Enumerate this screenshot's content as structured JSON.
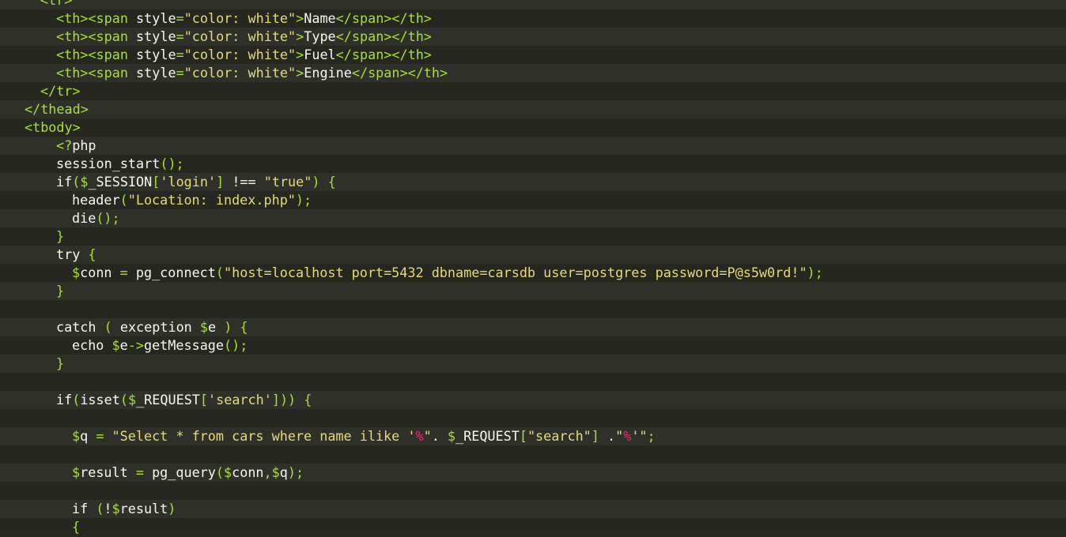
{
  "editor": {
    "language": "php",
    "colors": {
      "background": "#272822",
      "stripe_light": "#2f302a",
      "stripe_dark": "#262721",
      "text": "#f8f8f2",
      "punctuation": "#a6e22e",
      "string": "#e6db74",
      "accent": "#f92672"
    },
    "lines": [
      {
        "indent": 2,
        "tokens": [
          {
            "t": "<tr>",
            "c": "punc"
          }
        ]
      },
      {
        "indent": 3,
        "tokens": [
          {
            "t": "<th><span ",
            "c": "punc"
          },
          {
            "t": "style",
            "c": "text"
          },
          {
            "t": "=",
            "c": "punc"
          },
          {
            "t": "\"color: white\"",
            "c": "str"
          },
          {
            "t": ">",
            "c": "punc"
          },
          {
            "t": "Name",
            "c": "text"
          },
          {
            "t": "</span></th>",
            "c": "punc"
          }
        ]
      },
      {
        "indent": 3,
        "tokens": [
          {
            "t": "<th><span ",
            "c": "punc"
          },
          {
            "t": "style",
            "c": "text"
          },
          {
            "t": "=",
            "c": "punc"
          },
          {
            "t": "\"color: white\"",
            "c": "str"
          },
          {
            "t": ">",
            "c": "punc"
          },
          {
            "t": "Type",
            "c": "text"
          },
          {
            "t": "</span></th>",
            "c": "punc"
          }
        ]
      },
      {
        "indent": 3,
        "tokens": [
          {
            "t": "<th><span ",
            "c": "punc"
          },
          {
            "t": "style",
            "c": "text"
          },
          {
            "t": "=",
            "c": "punc"
          },
          {
            "t": "\"color: white\"",
            "c": "str"
          },
          {
            "t": ">",
            "c": "punc"
          },
          {
            "t": "Fuel",
            "c": "text"
          },
          {
            "t": "</span></th>",
            "c": "punc"
          }
        ]
      },
      {
        "indent": 3,
        "tokens": [
          {
            "t": "<th><span ",
            "c": "punc"
          },
          {
            "t": "style",
            "c": "text"
          },
          {
            "t": "=",
            "c": "punc"
          },
          {
            "t": "\"color: white\"",
            "c": "str"
          },
          {
            "t": ">",
            "c": "punc"
          },
          {
            "t": "Engine",
            "c": "text"
          },
          {
            "t": "</span></th>",
            "c": "punc"
          }
        ]
      },
      {
        "indent": 2,
        "tokens": [
          {
            "t": "</tr>",
            "c": "punc"
          }
        ]
      },
      {
        "indent": 1,
        "tokens": [
          {
            "t": "</thead>",
            "c": "punc"
          }
        ]
      },
      {
        "indent": 1,
        "tokens": [
          {
            "t": "<tbody>",
            "c": "punc"
          }
        ]
      },
      {
        "indent": 3,
        "tokens": [
          {
            "t": "<?",
            "c": "punc"
          },
          {
            "t": "php",
            "c": "text"
          }
        ]
      },
      {
        "indent": 3,
        "tokens": [
          {
            "t": "session_start",
            "c": "text"
          },
          {
            "t": "();",
            "c": "punc"
          }
        ]
      },
      {
        "indent": 3,
        "tokens": [
          {
            "t": "if",
            "c": "text"
          },
          {
            "t": "($",
            "c": "punc"
          },
          {
            "t": "_SESSION",
            "c": "text"
          },
          {
            "t": "[",
            "c": "punc"
          },
          {
            "t": "'login'",
            "c": "str"
          },
          {
            "t": "] ",
            "c": "punc"
          },
          {
            "t": "!== ",
            "c": "text"
          },
          {
            "t": "\"true\"",
            "c": "str"
          },
          {
            "t": ") {",
            "c": "punc"
          }
        ]
      },
      {
        "indent": 4,
        "tokens": [
          {
            "t": "header",
            "c": "text"
          },
          {
            "t": "(",
            "c": "punc"
          },
          {
            "t": "\"Location: index.php\"",
            "c": "str"
          },
          {
            "t": ");",
            "c": "punc"
          }
        ]
      },
      {
        "indent": 4,
        "tokens": [
          {
            "t": "die",
            "c": "text"
          },
          {
            "t": "();",
            "c": "punc"
          }
        ]
      },
      {
        "indent": 3,
        "tokens": [
          {
            "t": "}",
            "c": "punc"
          }
        ]
      },
      {
        "indent": 3,
        "tokens": [
          {
            "t": "try ",
            "c": "text"
          },
          {
            "t": "{",
            "c": "punc"
          }
        ]
      },
      {
        "indent": 4,
        "tokens": [
          {
            "t": "$",
            "c": "punc"
          },
          {
            "t": "conn ",
            "c": "text"
          },
          {
            "t": "= ",
            "c": "punc"
          },
          {
            "t": "pg_connect",
            "c": "text"
          },
          {
            "t": "(",
            "c": "punc"
          },
          {
            "t": "\"host=localhost port=5432 dbname=carsdb user=postgres password=P@s5w0rd!\"",
            "c": "str"
          },
          {
            "t": ");",
            "c": "punc"
          }
        ]
      },
      {
        "indent": 3,
        "tokens": [
          {
            "t": "}",
            "c": "punc"
          }
        ]
      },
      {
        "indent": 0,
        "tokens": []
      },
      {
        "indent": 3,
        "tokens": [
          {
            "t": "catch ",
            "c": "text"
          },
          {
            "t": "( ",
            "c": "punc"
          },
          {
            "t": "exception ",
            "c": "text"
          },
          {
            "t": "$",
            "c": "punc"
          },
          {
            "t": "e ",
            "c": "text"
          },
          {
            "t": ") {",
            "c": "punc"
          }
        ]
      },
      {
        "indent": 4,
        "tokens": [
          {
            "t": "echo ",
            "c": "text"
          },
          {
            "t": "$",
            "c": "punc"
          },
          {
            "t": "e",
            "c": "text"
          },
          {
            "t": "->",
            "c": "punc"
          },
          {
            "t": "getMessage",
            "c": "text"
          },
          {
            "t": "();",
            "c": "punc"
          }
        ]
      },
      {
        "indent": 3,
        "tokens": [
          {
            "t": "}",
            "c": "punc"
          }
        ]
      },
      {
        "indent": 0,
        "tokens": []
      },
      {
        "indent": 3,
        "tokens": [
          {
            "t": "if",
            "c": "text"
          },
          {
            "t": "(",
            "c": "punc"
          },
          {
            "t": "isset",
            "c": "text"
          },
          {
            "t": "($",
            "c": "punc"
          },
          {
            "t": "_REQUEST",
            "c": "text"
          },
          {
            "t": "[",
            "c": "punc"
          },
          {
            "t": "'search'",
            "c": "str"
          },
          {
            "t": "])) {",
            "c": "punc"
          }
        ]
      },
      {
        "indent": 0,
        "tokens": []
      },
      {
        "indent": 4,
        "tokens": [
          {
            "t": "$",
            "c": "punc"
          },
          {
            "t": "q ",
            "c": "text"
          },
          {
            "t": "= ",
            "c": "punc"
          },
          {
            "t": "\"Select * from cars where name ilike '",
            "c": "str"
          },
          {
            "t": "%",
            "c": "pink"
          },
          {
            "t": "\"",
            "c": "str"
          },
          {
            "t": ". ",
            "c": "text"
          },
          {
            "t": "$",
            "c": "punc"
          },
          {
            "t": "_REQUEST",
            "c": "text"
          },
          {
            "t": "[",
            "c": "punc"
          },
          {
            "t": "\"search\"",
            "c": "str"
          },
          {
            "t": "] ",
            "c": "punc"
          },
          {
            "t": ".",
            "c": "text"
          },
          {
            "t": "\"",
            "c": "str"
          },
          {
            "t": "%",
            "c": "pink"
          },
          {
            "t": "'\"",
            "c": "str"
          },
          {
            "t": ";",
            "c": "punc"
          }
        ]
      },
      {
        "indent": 0,
        "tokens": []
      },
      {
        "indent": 4,
        "tokens": [
          {
            "t": "$",
            "c": "punc"
          },
          {
            "t": "result ",
            "c": "text"
          },
          {
            "t": "= ",
            "c": "punc"
          },
          {
            "t": "pg_query",
            "c": "text"
          },
          {
            "t": "($",
            "c": "punc"
          },
          {
            "t": "conn",
            "c": "text"
          },
          {
            "t": ",$",
            "c": "punc"
          },
          {
            "t": "q",
            "c": "text"
          },
          {
            "t": ");",
            "c": "punc"
          }
        ]
      },
      {
        "indent": 0,
        "tokens": []
      },
      {
        "indent": 4,
        "tokens": [
          {
            "t": "if ",
            "c": "text"
          },
          {
            "t": "(",
            "c": "punc"
          },
          {
            "t": "!",
            "c": "text"
          },
          {
            "t": "$",
            "c": "punc"
          },
          {
            "t": "result",
            "c": "text"
          },
          {
            "t": ")",
            "c": "punc"
          }
        ]
      },
      {
        "indent": 4,
        "tokens": [
          {
            "t": "{",
            "c": "punc"
          }
        ]
      }
    ]
  }
}
